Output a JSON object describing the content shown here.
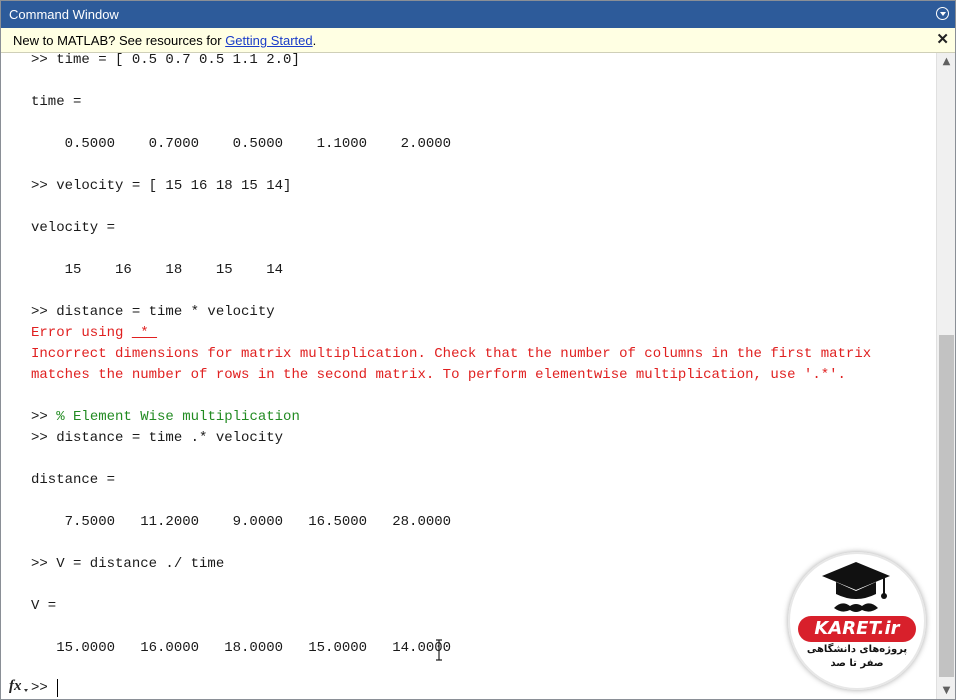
{
  "window": {
    "title": "Command Window"
  },
  "notice": {
    "text": "New to MATLAB? See resources for ",
    "link": "Getting Started",
    "suffix": ".",
    "close": "✕"
  },
  "console": {
    "lines": [
      {
        "type": "input",
        "text": ">> time = [ 0.5 0.7 0.5 1.1 2.0]"
      },
      {
        "type": "blank",
        "text": ""
      },
      {
        "type": "output",
        "text": "time ="
      },
      {
        "type": "blank",
        "text": ""
      },
      {
        "type": "output",
        "text": "    0.5000    0.7000    0.5000    1.1000    2.0000"
      },
      {
        "type": "blank",
        "text": ""
      },
      {
        "type": "input",
        "text": ">> velocity = [ 15 16 18 15 14]"
      },
      {
        "type": "blank",
        "text": ""
      },
      {
        "type": "output",
        "text": "velocity ="
      },
      {
        "type": "blank",
        "text": ""
      },
      {
        "type": "output",
        "text": "    15    16    18    15    14"
      },
      {
        "type": "blank",
        "text": ""
      },
      {
        "type": "input",
        "text": ">> distance = time * velocity"
      },
      {
        "type": "error-link",
        "text": "Error using ",
        "link": " * "
      },
      {
        "type": "error",
        "text": "Incorrect dimensions for matrix multiplication. Check that the number of columns in the first matrix"
      },
      {
        "type": "error",
        "text": "matches the number of rows in the second matrix. To perform elementwise multiplication, use '.*'."
      },
      {
        "type": "blank",
        "text": ""
      },
      {
        "type": "comment",
        "prefix": ">> ",
        "text": "% Element Wise multiplication"
      },
      {
        "type": "input",
        "text": ">> distance = time .* velocity"
      },
      {
        "type": "blank",
        "text": ""
      },
      {
        "type": "output",
        "text": "distance ="
      },
      {
        "type": "blank",
        "text": ""
      },
      {
        "type": "output",
        "text": "    7.5000   11.2000    9.0000   16.5000   28.0000"
      },
      {
        "type": "blank",
        "text": ""
      },
      {
        "type": "input",
        "text": ">> V = distance ./ time"
      },
      {
        "type": "blank",
        "text": ""
      },
      {
        "type": "output",
        "text": "V ="
      },
      {
        "type": "blank",
        "text": ""
      },
      {
        "type": "output",
        "text": "   15.0000   16.0000   18.0000   15.0000   14.0000"
      }
    ],
    "prompt": ">>",
    "fx_label": "fx"
  },
  "watermark": {
    "brand": "KARET.ir",
    "tagline1": "پروژه‌های دانشگاهی",
    "tagline2": "صفر تا صد"
  },
  "colors": {
    "titlebar": "#2d5b9a",
    "notice_bg": "#ffffe3",
    "error": "#e02020",
    "comment": "#228b22",
    "link": "#1a3cc9"
  }
}
